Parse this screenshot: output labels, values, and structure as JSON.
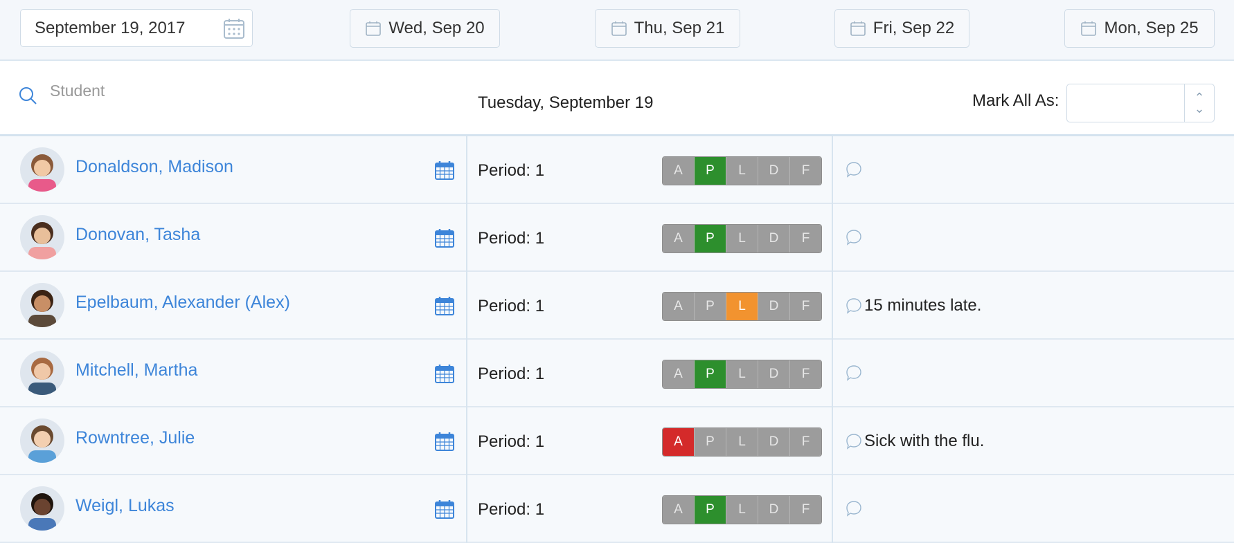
{
  "topbar": {
    "selected_date": "September 19, 2017",
    "day_buttons": [
      "Wed, Sep 20",
      "Thu, Sep 21",
      "Fri, Sep 22",
      "Mon, Sep 25"
    ]
  },
  "header": {
    "search_placeholder": "Student",
    "day_title": "Tuesday, September 19",
    "mark_all_label": "Mark All As:"
  },
  "codes": [
    "A",
    "P",
    "L",
    "D",
    "F"
  ],
  "students": [
    {
      "name": "Donaldson, Madison",
      "period": "Period: 1",
      "status": "P",
      "comment": ""
    },
    {
      "name": "Donovan, Tasha",
      "period": "Period: 1",
      "status": "P",
      "comment": ""
    },
    {
      "name": "Epelbaum, Alexander (Alex)",
      "period": "Period: 1",
      "status": "L",
      "comment": "15 minutes late."
    },
    {
      "name": "Mitchell, Martha",
      "period": "Period: 1",
      "status": "P",
      "comment": ""
    },
    {
      "name": "Rowntree, Julie",
      "period": "Period: 1",
      "status": "A",
      "comment": "Sick with the flu."
    },
    {
      "name": "Weigl, Lukas",
      "period": "Period: 1",
      "status": "P",
      "comment": ""
    }
  ],
  "colors": {
    "present": "#2d8f2d",
    "late": "#f2932f",
    "absent": "#d42a2a",
    "link": "#3d85d9"
  }
}
